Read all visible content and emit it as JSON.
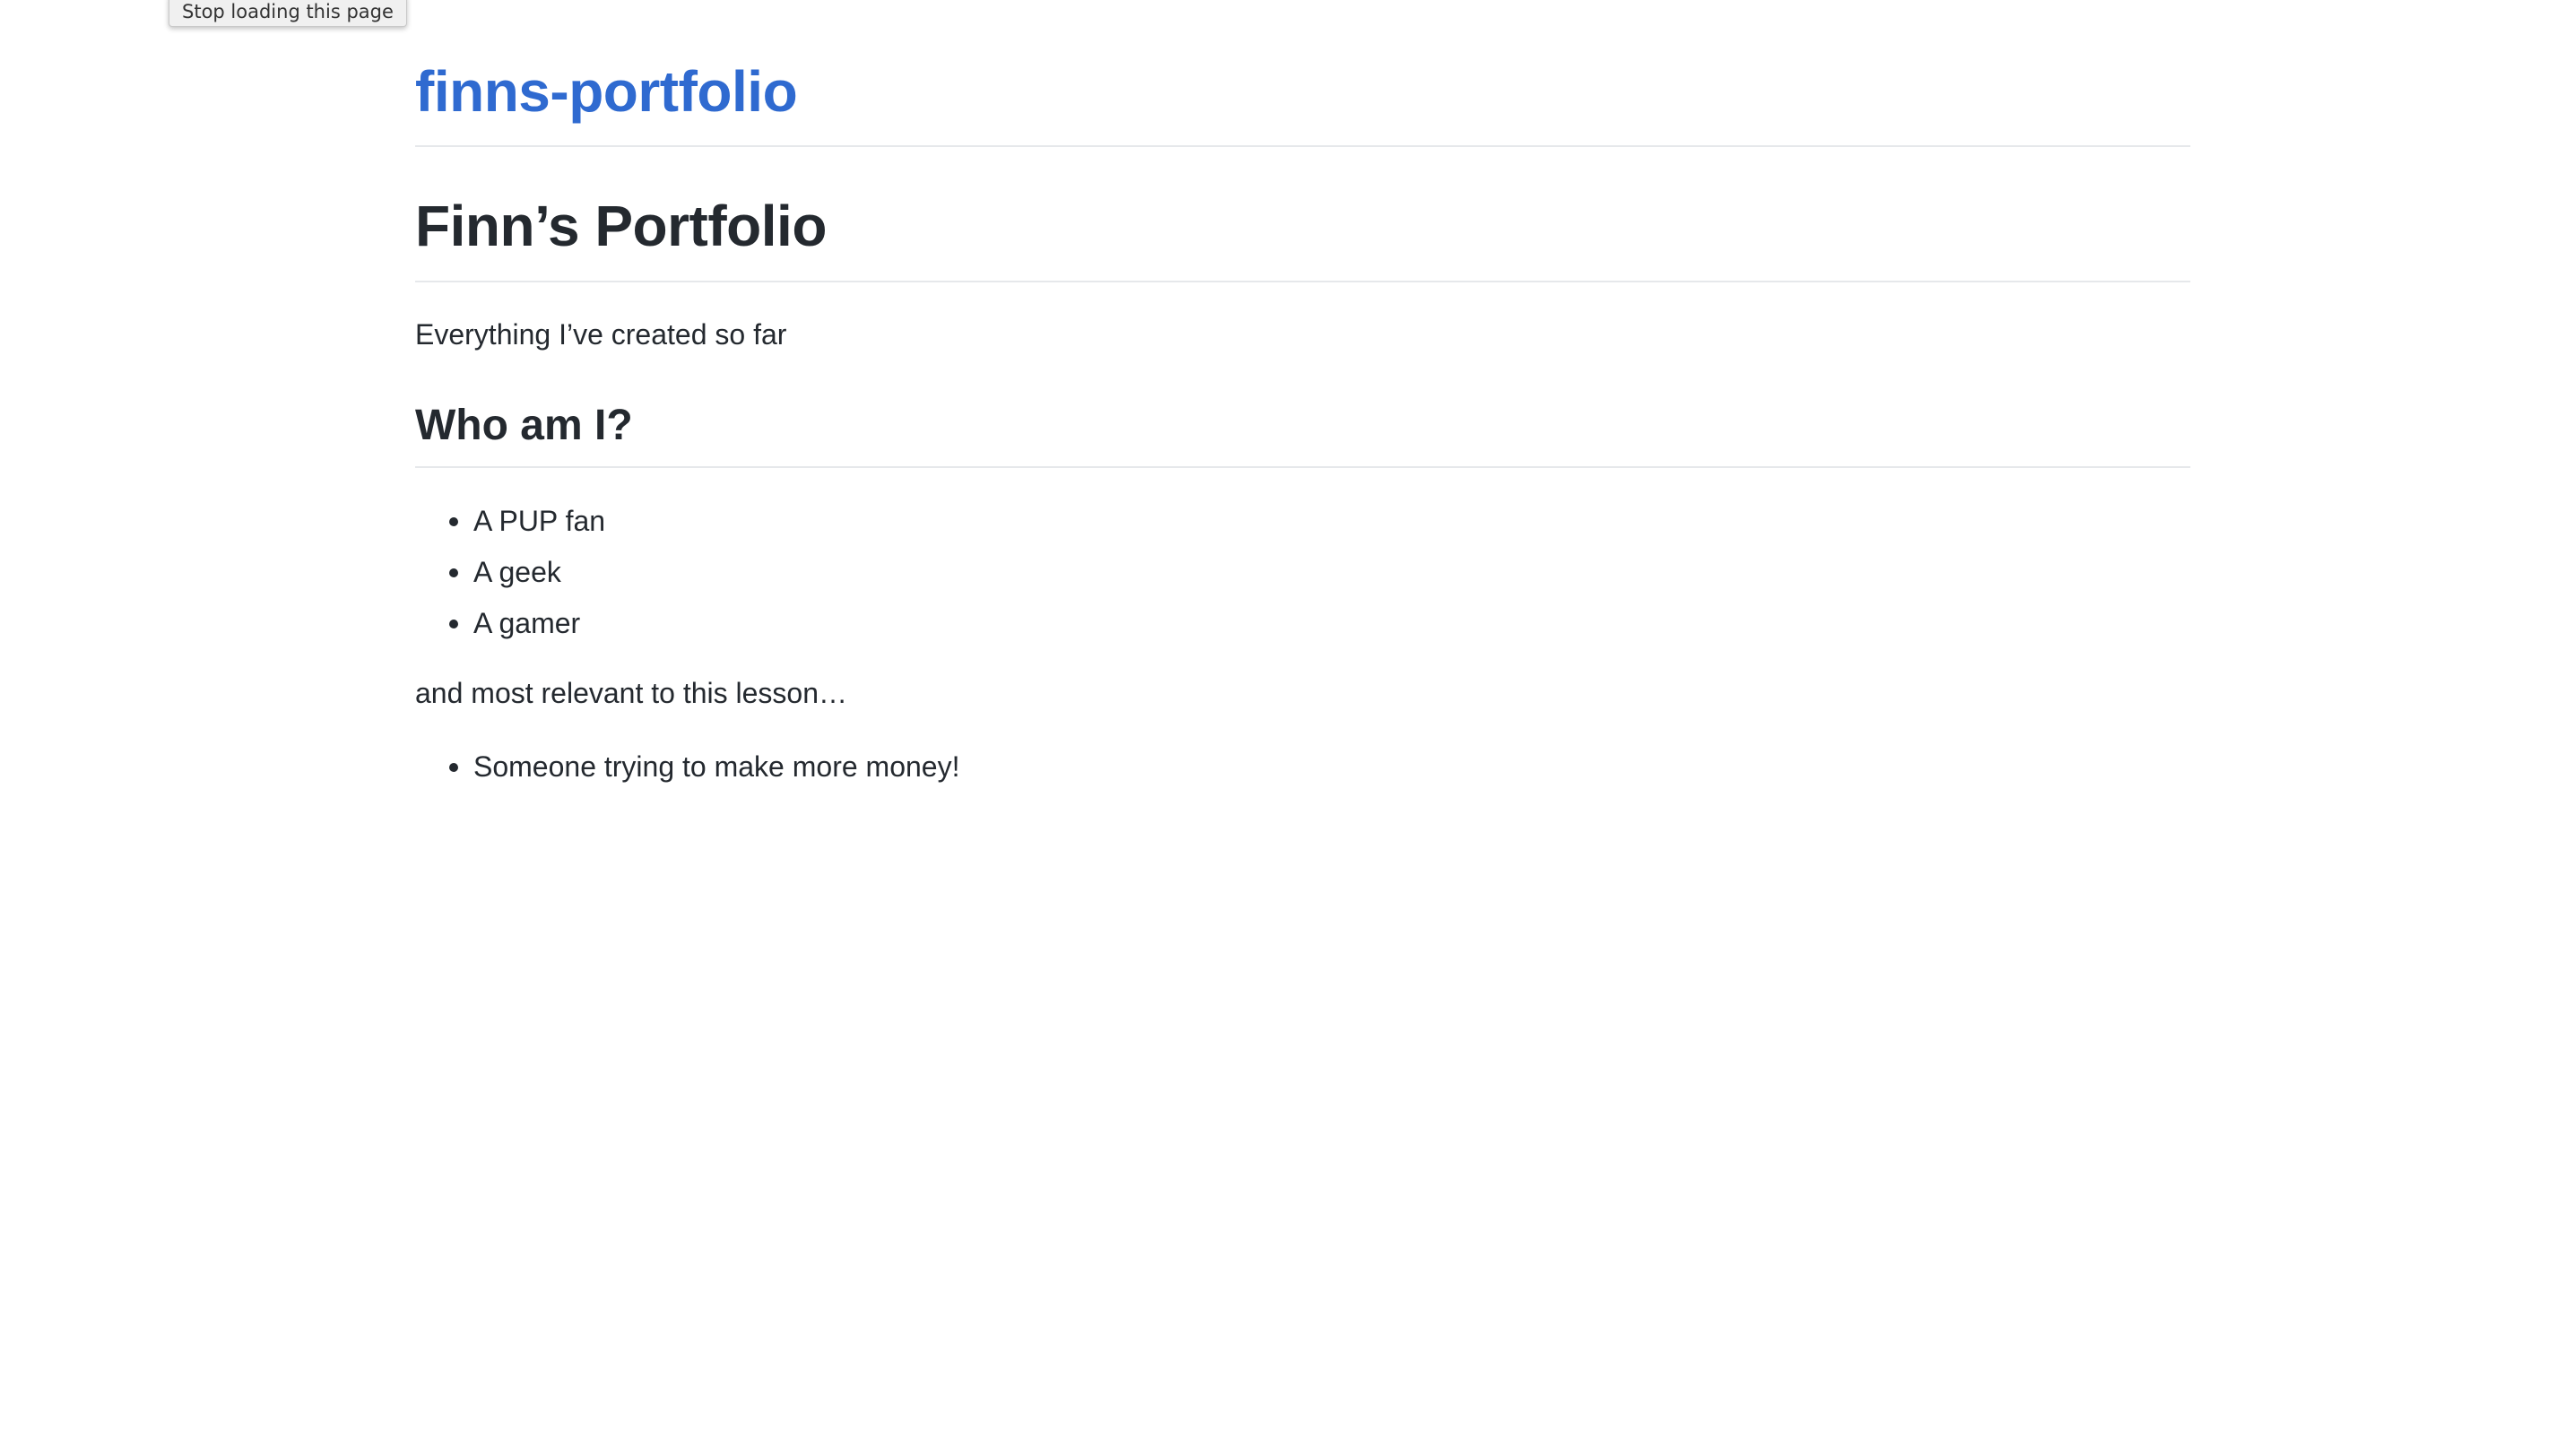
{
  "browser": {
    "tooltip": "Stop loading this page"
  },
  "header": {
    "site_title": "finns-portfolio"
  },
  "main": {
    "title": "Finn’s Portfolio",
    "tagline": "Everything I’ve created so far",
    "section_heading": "Who am I?",
    "traits": [
      "A PUP fan",
      "A geek",
      "A gamer"
    ],
    "relevant_intro": "and most relevant to this lesson…",
    "relevant_items": [
      "Someone trying to make more money!"
    ]
  },
  "colors": {
    "link": "#2f6ad0",
    "text": "#24292f",
    "rule": "#e6e8eb"
  }
}
